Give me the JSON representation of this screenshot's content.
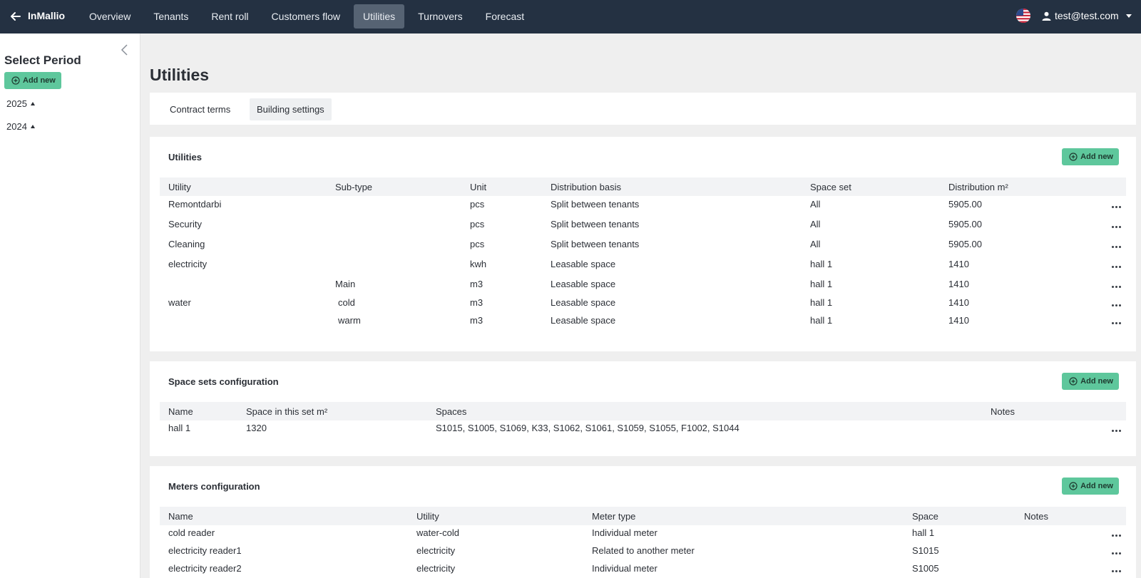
{
  "app": {
    "brand": "InMallio"
  },
  "nav": [
    {
      "label": "Overview",
      "active": false
    },
    {
      "label": "Tenants",
      "active": false
    },
    {
      "label": "Rent roll",
      "active": false
    },
    {
      "label": "Customers flow",
      "active": false
    },
    {
      "label": "Utilities",
      "active": true
    },
    {
      "label": "Turnovers",
      "active": false
    },
    {
      "label": "Forecast",
      "active": false
    }
  ],
  "user": {
    "email": "test@test.com"
  },
  "sidebar": {
    "title": "Select Period",
    "add_label": "Add new",
    "years": [
      "2025",
      "2024"
    ]
  },
  "page": {
    "title": "Utilities"
  },
  "tabs": [
    {
      "label": "Contract terms",
      "active": false
    },
    {
      "label": "Building settings",
      "active": true
    }
  ],
  "utilities": {
    "title": "Utilities",
    "add_label": "Add new",
    "columns": [
      "Utility",
      "Sub-type",
      "Unit",
      "Distribution basis",
      "Space set",
      "Distribution m²"
    ],
    "rows": [
      {
        "utility": "Remontdarbi",
        "subtype": "",
        "unit": "pcs",
        "basis": "Split between tenants",
        "space_set": "All",
        "distribution": "5905.00"
      },
      {
        "utility": "Security",
        "subtype": "",
        "unit": "pcs",
        "basis": "Split between tenants",
        "space_set": "All",
        "distribution": "5905.00"
      },
      {
        "utility": "Cleaning",
        "subtype": "",
        "unit": "pcs",
        "basis": "Split between tenants",
        "space_set": "All",
        "distribution": "5905.00"
      },
      {
        "utility": "electricity",
        "subtype": "",
        "unit": "kwh",
        "basis": "Leasable space",
        "space_set": "hall 1",
        "distribution": "1410"
      },
      {
        "utility": "",
        "subtype": "Main",
        "unit": "m3",
        "basis": "Leasable space",
        "space_set": "hall 1",
        "distribution": "1410"
      },
      {
        "utility": "water",
        "subtype": "cold",
        "unit": "m3",
        "basis": "Leasable space",
        "space_set": "hall 1",
        "distribution": "1410"
      },
      {
        "utility": "",
        "subtype": "warm",
        "unit": "m3",
        "basis": "Leasable space",
        "space_set": "hall 1",
        "distribution": "1410"
      }
    ]
  },
  "space_sets": {
    "title": "Space sets configuration",
    "add_label": "Add new",
    "columns": [
      "Name",
      "Space in this set m²",
      "Spaces",
      "Notes"
    ],
    "rows": [
      {
        "name": "hall 1",
        "space": "1320",
        "spaces": "S1015, S1005, S1069, K33, S1062, S1061, S1059, S1055, F1002, S1044",
        "notes": ""
      }
    ]
  },
  "meters": {
    "title": "Meters configuration",
    "add_label": "Add new",
    "columns": [
      "Name",
      "Utility",
      "Meter type",
      "Space",
      "Notes"
    ],
    "rows": [
      {
        "name": "cold reader",
        "utility": "water-cold",
        "type": "Individual meter",
        "space": "hall 1",
        "notes": ""
      },
      {
        "name": "electricity reader1",
        "utility": "electricity",
        "type": "Related to another meter",
        "space": "S1015",
        "notes": ""
      },
      {
        "name": "electricity reader2",
        "utility": "electricity",
        "type": "Individual meter",
        "space": "S1005",
        "notes": ""
      }
    ]
  },
  "colors": {
    "topbar": "#243142",
    "nav_active": "#566373",
    "accent_green": "#5ec79c",
    "header_row": "#f2f3f5"
  }
}
